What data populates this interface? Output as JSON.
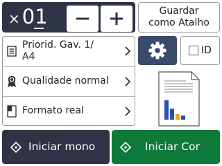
{
  "copies": {
    "times_symbol": "×",
    "count": "01",
    "minus_symbol": "−",
    "plus_symbol": "+"
  },
  "shortcut": {
    "line1": "Guardar",
    "line2": "como Atalho"
  },
  "settings": [
    {
      "icon": "tray-icon",
      "line1": "Priorid. Gav. 1/",
      "line2": "A4"
    },
    {
      "icon": "quality-ribbon-icon",
      "label": "Qualidade normal"
    },
    {
      "icon": "format-icon",
      "label": "Formato real"
    }
  ],
  "id_button": {
    "label": "ID"
  },
  "gear_button": {
    "icon": "gear-icon"
  },
  "start_buttons": {
    "mono": "Iniciar mono",
    "color": "Iniciar Cor"
  },
  "colors": {
    "dark_navy": "#2e3445",
    "gear_blue": "#3a4a6b",
    "start_green": "#0e7a3a",
    "chart_blue": "#2b4fb0",
    "chart_orange": "#f0a020"
  }
}
